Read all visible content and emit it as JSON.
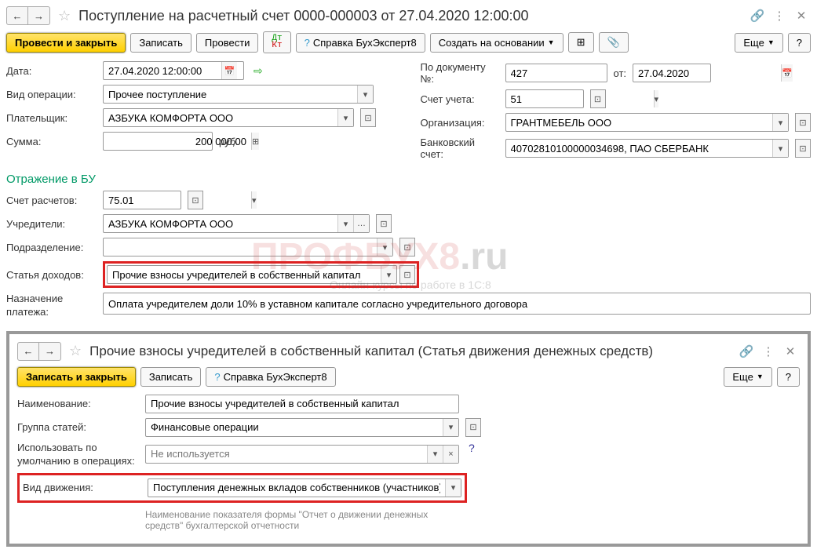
{
  "main": {
    "title": "Поступление на расчетный счет 0000-000003 от 27.04.2020 12:00:00",
    "toolbar": {
      "post_close": "Провести и закрыть",
      "save": "Записать",
      "post": "Провести",
      "help_ref": "Справка БухЭксперт8",
      "create_based": "Создать на основании",
      "more": "Еще"
    },
    "fields": {
      "date_label": "Дата:",
      "date_value": "27.04.2020 12:00:00",
      "doc_num_label": "По документу №:",
      "doc_num_value": "427",
      "doc_from_label": "от:",
      "doc_from_value": "27.04.2020",
      "op_type_label": "Вид операции:",
      "op_type_value": "Прочее поступление",
      "account_label": "Счет учета:",
      "account_value": "51",
      "payer_label": "Плательщик:",
      "payer_value": "АЗБУКА КОМФОРТА ООО",
      "org_label": "Организация:",
      "org_value": "ГРАНТМЕБЕЛЬ ООО",
      "sum_label": "Сумма:",
      "sum_value": "200 000,00",
      "sum_currency": "руб.",
      "bank_account_label": "Банковский счет:",
      "bank_account_value": "40702810100000034698, ПАО СБЕРБАНК"
    },
    "bu_section": {
      "title": "Отражение в БУ",
      "account_label": "Счет расчетов:",
      "account_value": "75.01",
      "founders_label": "Учредители:",
      "founders_value": "АЗБУКА КОМФОРТА ООО",
      "division_label": "Подразделение:",
      "income_label": "Статья доходов:",
      "income_value": "Прочие взносы учредителей в собственный капитал",
      "purpose_label": "Назначение платежа:",
      "purpose_value": "Оплата учредителем доли 10% в уставном капитале согласно учредительного договора"
    }
  },
  "sub": {
    "title": "Прочие взносы учредителей в собственный капитал (Статья движения денежных средств)",
    "toolbar": {
      "save_close": "Записать и закрыть",
      "save": "Записать",
      "help_ref": "Справка БухЭксперт8",
      "more": "Еще"
    },
    "fields": {
      "name_label": "Наименование:",
      "name_value": "Прочие взносы учредителей в собственный капитал",
      "group_label": "Группа статей:",
      "group_value": "Финансовые операции",
      "default_use_label": "Использовать по умолчанию в операциях:",
      "default_use_placeholder": "Не используется",
      "movement_label": "Вид движения:",
      "movement_value": "Поступления денежных вкладов собственников (участников)",
      "movement_hint": "Наименование показателя формы \"Отчет о движении денежных средств\" бухгалтерской отчетности"
    }
  },
  "watermark": "ПРОФБУХ8",
  "watermark_domain": ".ru",
  "watermark_sub": "Онлайн-курсы по работе в 1С:8"
}
